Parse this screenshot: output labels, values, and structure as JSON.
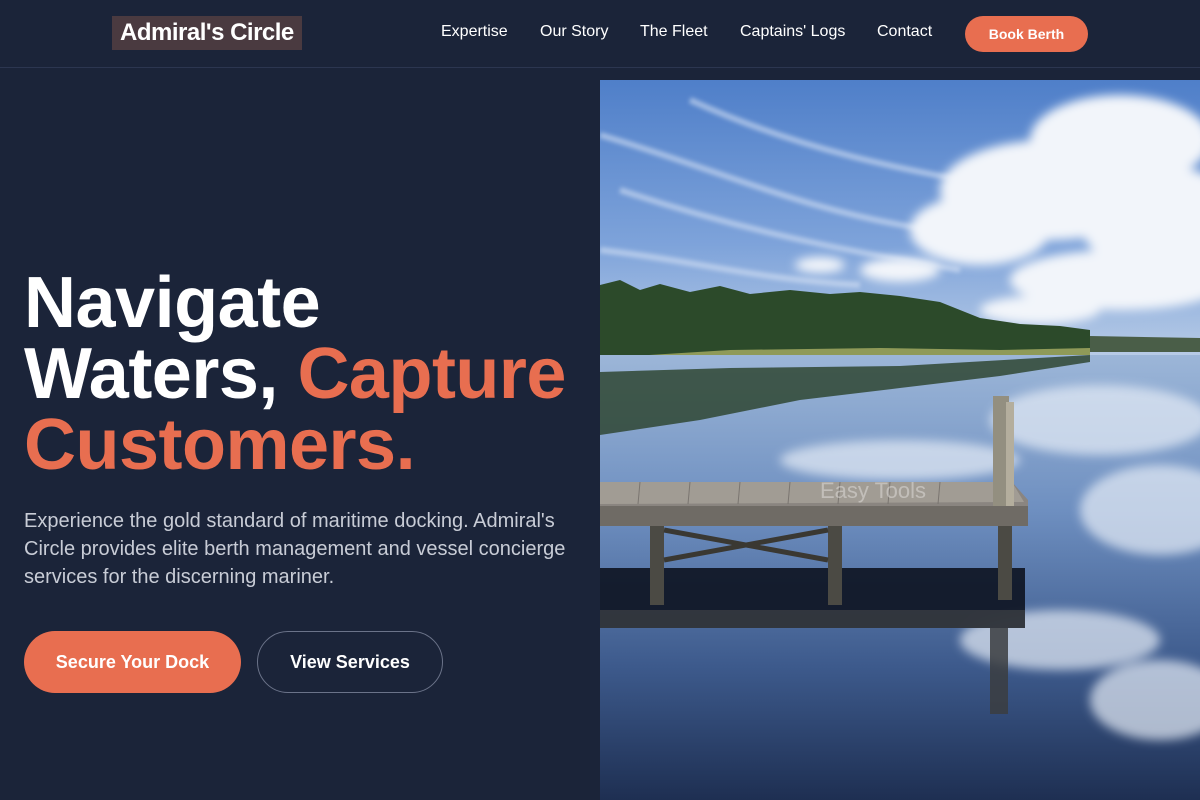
{
  "brand": {
    "name": "Admiral's Circle"
  },
  "nav": {
    "links": [
      "Expertise",
      "Our Story",
      "The Fleet",
      "Captains' Logs",
      "Contact"
    ],
    "cta_label": "Book Berth"
  },
  "hero": {
    "title_line1": "Navigate",
    "title_line2_plain": "Waters,",
    "title_line2_accent": "Capture",
    "title_line3_accent": "Customers.",
    "description": "Experience the gold standard of maritime docking. Admiral's Circle provides elite berth management and vessel concierge services for the discerning mariner.",
    "primary_button": "Secure Your Dock",
    "secondary_button": "View Services"
  },
  "image": {
    "subject": "lake-dock-photo",
    "watermark": "Easy Tools"
  },
  "colors": {
    "background": "#1b2439",
    "accent": "#e86e50",
    "logo_bg": "#4a3a40",
    "muted_text": "#c8ccd6"
  }
}
